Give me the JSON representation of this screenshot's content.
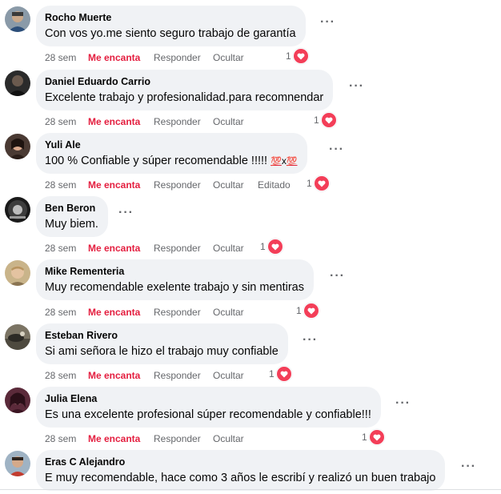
{
  "labels": {
    "like": "Me encanta",
    "reply": "Responder",
    "hide": "Ocultar",
    "edited": "Editado",
    "more": "···"
  },
  "colors": {
    "bubble": "#f0f2f5",
    "like_active": "#e41e3f",
    "heart": "#f33e58",
    "secondary_text": "#65676b"
  },
  "comments": [
    {
      "author": "Rocho Muerte",
      "text": "Con vos yo.me siento seguro trabajo de garantía",
      "time": "28 sem",
      "reaction_count": "1",
      "reaction_icon": "heart-icon"
    },
    {
      "author": "Daniel Eduardo Carrio",
      "text": "Excelente trabajo y profesionalidad.para recomnendar",
      "time": "28 sem",
      "reaction_count": "1",
      "reaction_icon": "heart-icon"
    },
    {
      "author": "Yuli Ale",
      "text": "100 % Confiable y súper recomendable !!!!! ",
      "emoji_a": "💯",
      "emoji_x": "x",
      "emoji_b": "💯",
      "time": "28 sem",
      "edited": "Editado",
      "reaction_count": "1",
      "reaction_icon": "heart-icon"
    },
    {
      "author": "Ben Beron",
      "text": "Muy biem.",
      "time": "28 sem",
      "reaction_count": "1",
      "reaction_icon": "heart-icon"
    },
    {
      "author": "Mike Rementeria",
      "text": "Muy recomendable exelente trabajo y sin mentiras",
      "time": "28 sem",
      "reaction_count": "1",
      "reaction_icon": "heart-icon"
    },
    {
      "author": "Esteban Rivero",
      "text": "Si ami señora le hizo el trabajo muy confiable",
      "time": "28 sem",
      "reaction_count": "1",
      "reaction_icon": "heart-icon"
    },
    {
      "author": "Julia Elena",
      "text": "Es una excelente profesional súper recomendable y confiable!!!",
      "time": "28 sem",
      "reaction_count": "1",
      "reaction_icon": "heart-icon"
    },
    {
      "author": "Eras C Alejandro",
      "text": "E muy recomendable, hace como 3 años le escribí y realizó un buen trabajo"
    }
  ]
}
